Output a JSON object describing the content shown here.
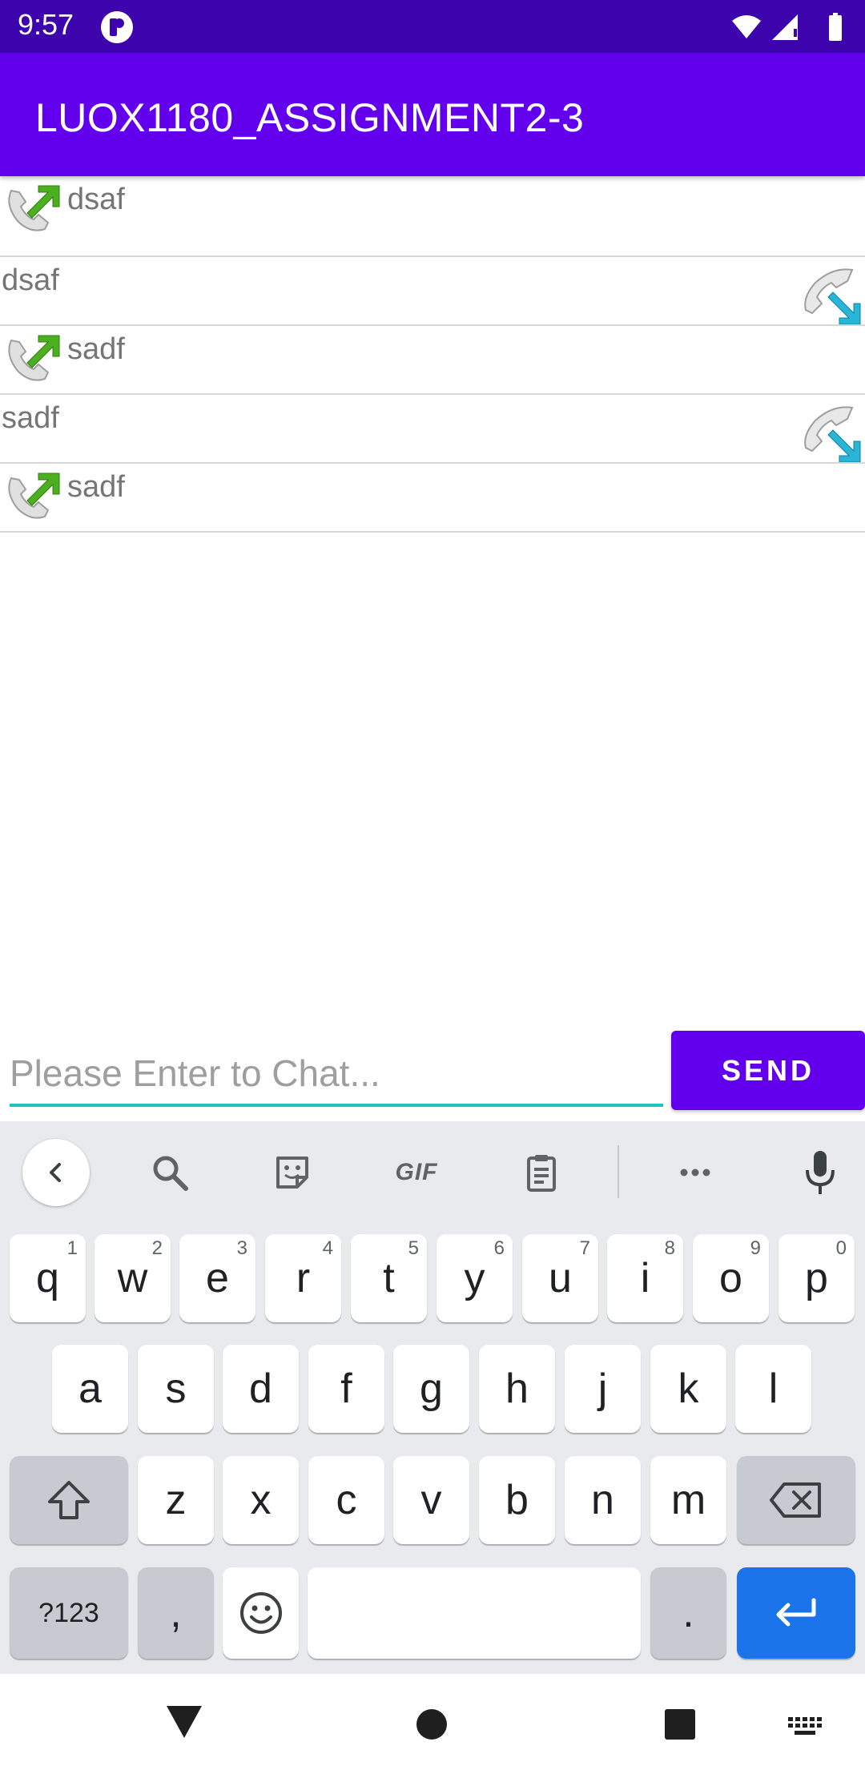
{
  "status_bar": {
    "time": "9:57"
  },
  "app_bar": {
    "title": "LUOX1180_ASSIGNMENT2-3"
  },
  "messages": [
    {
      "text": "dsaf",
      "direction": "outgoing"
    },
    {
      "text": "dsaf",
      "direction": "incoming"
    },
    {
      "text": "sadf",
      "direction": "outgoing"
    },
    {
      "text": "sadf",
      "direction": "incoming"
    },
    {
      "text": "sadf",
      "direction": "outgoing"
    }
  ],
  "composer": {
    "placeholder": "Please Enter to Chat...",
    "value": "",
    "send_label": "SEND"
  },
  "keyboard": {
    "toolbar": {
      "gif_label": "GIF"
    },
    "row1": [
      {
        "key": "q",
        "hint": "1"
      },
      {
        "key": "w",
        "hint": "2"
      },
      {
        "key": "e",
        "hint": "3"
      },
      {
        "key": "r",
        "hint": "4"
      },
      {
        "key": "t",
        "hint": "5"
      },
      {
        "key": "y",
        "hint": "6"
      },
      {
        "key": "u",
        "hint": "7"
      },
      {
        "key": "i",
        "hint": "8"
      },
      {
        "key": "o",
        "hint": "9"
      },
      {
        "key": "p",
        "hint": "0"
      }
    ],
    "row2": [
      "a",
      "s",
      "d",
      "f",
      "g",
      "h",
      "j",
      "k",
      "l"
    ],
    "row3": [
      "z",
      "x",
      "c",
      "v",
      "b",
      "n",
      "m"
    ],
    "symbols_label": "?123",
    "comma_label": ",",
    "period_label": "."
  },
  "colors": {
    "status_bar": "#3d04ad",
    "primary": "#6200ee",
    "accent_underline": "#1bc5b7",
    "enter_key": "#1a73e8"
  },
  "icons": {
    "outgoing": "outgoing-call-icon",
    "incoming": "incoming-call-icon"
  }
}
